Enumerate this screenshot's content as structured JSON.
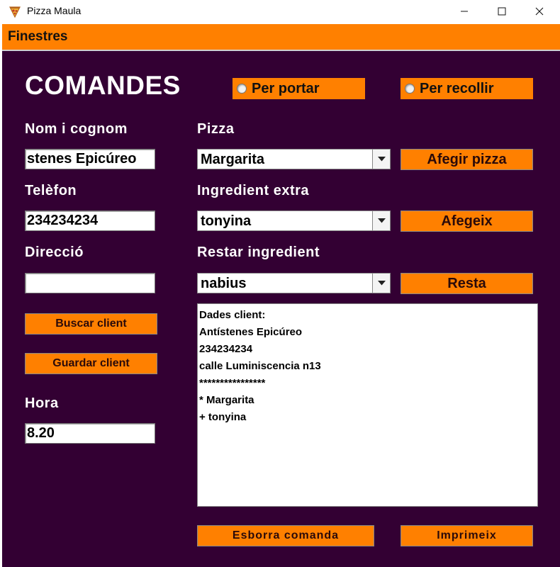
{
  "window": {
    "title": "Pizza Maula",
    "icon": "pizza-icon",
    "controls": [
      "minimize-icon",
      "maximize-icon",
      "close-icon"
    ]
  },
  "menu": {
    "items": [
      "Finestres"
    ]
  },
  "colors": {
    "background": "#330033",
    "accent": "#ff8000",
    "text": "#ffffff"
  },
  "form": {
    "heading": "COMANDES",
    "delivery_option": "Per portar",
    "pickup_option": "Per recollir",
    "name_label": "Nom i cognom",
    "name_value": "stenes Epicúreo",
    "phone_label": "Telèfon",
    "phone_value": "234234234",
    "address_label": "Direcció",
    "address_value": "",
    "search_client_button": "Buscar client",
    "save_client_button": "Guardar client",
    "time_label": "Hora",
    "time_value": "8.20",
    "pizza_label": "Pizza",
    "pizza_selected": "Margarita",
    "add_pizza_button": "Afegir pizza",
    "extra_ingredient_label": "Ingredient extra",
    "extra_ingredient_selected": "tonyina",
    "add_ingredient_button": "Afegeix",
    "remove_ingredient_label": "Restar ingredient",
    "remove_ingredient_selected": "nabius",
    "remove_ingredient_button": "Resta",
    "delete_order_button": "Esborra comanda",
    "print_button": "Imprimeix"
  },
  "order_summary": {
    "lines": [
      "Dades client:",
      "Antístenes Epicúreo",
      "234234234",
      "calle Luminiscencia n13",
      "****************",
      "* Margarita",
      "+ tonyina"
    ]
  }
}
